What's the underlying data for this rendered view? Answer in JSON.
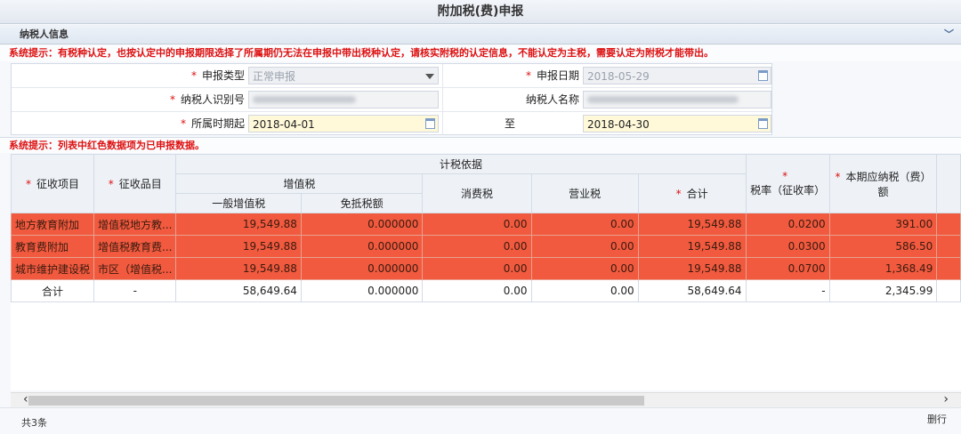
{
  "page_title": "附加税(费)申报",
  "panel_title": "纳税人信息",
  "notice1": "系统提示：有税种认定，也按认定中的申报期限选择了所属期仍无法在申报中带出税种认定，请核实附税的认定信息，不能认定为主税，需要认定为附税才能带出。",
  "notice2": "系统提示：列表中红色数据项为已申报数据。",
  "form": {
    "declare_type_label": "申报类型",
    "declare_type_value": "正常申报",
    "declare_date_label": "申报日期",
    "declare_date_value": "2018-05-29",
    "taxpayer_id_label": "纳税人识别号",
    "taxpayer_name_label": "纳税人名称",
    "period_start_label": "所属时期起",
    "period_start_value": "2018-04-01",
    "period_to_label": "至",
    "period_end_value": "2018-04-30"
  },
  "table": {
    "headers": {
      "levy_item": "征收项目",
      "levy_subitem": "征收品目",
      "tax_basis": "计税依据",
      "vat": "增值税",
      "general_vat": "一般增值税",
      "exempt_offset": "免抵税额",
      "consumption_tax": "消费税",
      "business_tax": "营业税",
      "subtotal": "合计",
      "tax_rate": "税率（征收率）",
      "payable": "本期应纳税（费）额"
    },
    "rows": [
      {
        "item": "地方教育附加",
        "subitem": "增值税地方教...",
        "general_vat": "19,549.88",
        "exempt": "0.000000",
        "consumption": "0.00",
        "business": "0.00",
        "subtotal": "19,549.88",
        "rate": "0.0200",
        "payable": "391.00"
      },
      {
        "item": "教育费附加",
        "subitem": "增值税教育费...",
        "general_vat": "19,549.88",
        "exempt": "0.000000",
        "consumption": "0.00",
        "business": "0.00",
        "subtotal": "19,549.88",
        "rate": "0.0300",
        "payable": "586.50"
      },
      {
        "item": "城市维护建设税",
        "subitem": "市区（增值税...",
        "general_vat": "19,549.88",
        "exempt": "0.000000",
        "consumption": "0.00",
        "business": "0.00",
        "subtotal": "19,549.88",
        "rate": "0.0700",
        "payable": "1,368.49"
      }
    ],
    "total": {
      "item": "合计",
      "subitem": "-",
      "general_vat": "58,649.64",
      "exempt": "0.000000",
      "consumption": "0.00",
      "business": "0.00",
      "subtotal": "58,649.64",
      "rate": "-",
      "payable": "2,345.99"
    }
  },
  "footer": {
    "count": "共3条",
    "right_button": "删行"
  },
  "colors": {
    "declared_row": "#f15a3e",
    "required_star": "#dd1111",
    "highlight_field": "#fff9d9"
  }
}
